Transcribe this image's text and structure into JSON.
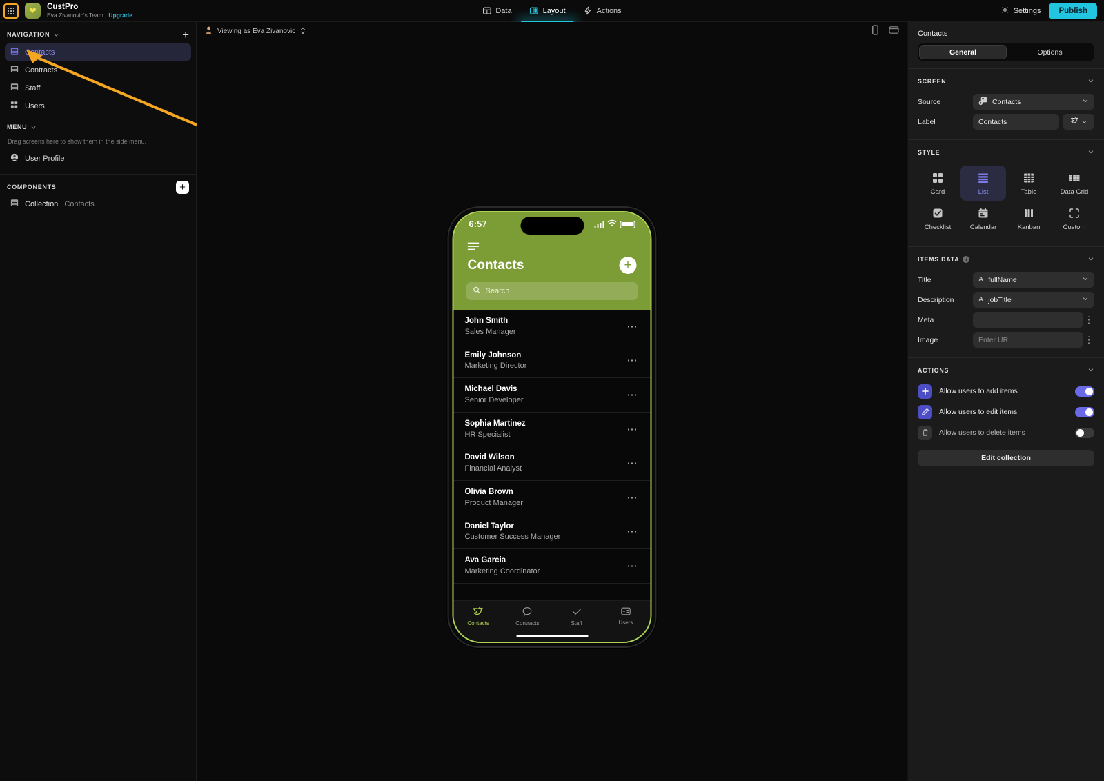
{
  "topbar": {
    "grid_icon": "grid-apps-icon",
    "logo_icon": "app-logo-icon",
    "app_title": "CustPro",
    "team": "Eva Zivanovic's Team",
    "sep": "·",
    "upgrade": "Upgrade",
    "tabs": [
      {
        "label": "Data",
        "icon": "data-table-icon",
        "active": false
      },
      {
        "label": "Layout",
        "icon": "layout-columns-icon",
        "active": true
      },
      {
        "label": "Actions",
        "icon": "lightning-bolt-icon",
        "active": false
      }
    ],
    "settings": "Settings",
    "publish": "Publish"
  },
  "sidebar": {
    "navigation": {
      "title": "NAVIGATION",
      "add_label": "+"
    },
    "nav_items": [
      {
        "label": "Contacts",
        "icon": "list-screen-icon",
        "active": true
      },
      {
        "label": "Contracts",
        "icon": "list-screen-icon",
        "active": false
      },
      {
        "label": "Staff",
        "icon": "list-screen-icon",
        "active": false
      },
      {
        "label": "Users",
        "icon": "grid-screen-icon",
        "active": false
      }
    ],
    "menu": {
      "title": "MENU",
      "hint": "Drag screens here to show them in the side menu."
    },
    "menu_items": [
      {
        "label": "User Profile",
        "icon": "user-avatar-icon"
      }
    ],
    "components": {
      "title": "COMPONENTS",
      "add_label": "+"
    },
    "component_items": [
      {
        "label": "Collection",
        "sub": "Contacts",
        "icon": "collection-icon"
      }
    ]
  },
  "canvas": {
    "viewing_as": "Viewing as Eva Zivanovic",
    "avatar_icon": "person-avatar-icon",
    "selector_icon": "up-down-chevron-icon",
    "mobile_view_icon": "mobile-device-icon",
    "desktop_view_icon": "desktop-device-icon"
  },
  "phone": {
    "status": {
      "time": "6:57",
      "signal_icon": "cellular-bars-icon",
      "wifi_icon": "wifi-icon",
      "battery_icon": "battery-icon"
    },
    "menu_icon": "hamburger-menu-icon",
    "title": "Contacts",
    "add_icon": "plus-circle-icon",
    "search_placeholder": "Search",
    "search_icon": "search-icon",
    "row_menu_icon": "ellipsis-icon",
    "contacts": [
      {
        "name": "John Smith",
        "job": "Sales Manager"
      },
      {
        "name": "Emily Johnson",
        "job": "Marketing Director"
      },
      {
        "name": "Michael Davis",
        "job": "Senior Developer"
      },
      {
        "name": "Sophia Martinez",
        "job": "HR Specialist"
      },
      {
        "name": "David Wilson",
        "job": "Financial Analyst"
      },
      {
        "name": "Olivia Brown",
        "job": "Product Manager"
      },
      {
        "name": "Daniel Taylor",
        "job": "Customer Success Manager"
      },
      {
        "name": "Ava Garcia",
        "job": "Marketing Coordinator"
      }
    ],
    "tabs": [
      {
        "label": "Contacts",
        "icon": "bird-icon",
        "active": true
      },
      {
        "label": "Contracts",
        "icon": "speech-bubble-icon",
        "active": false
      },
      {
        "label": "Staff",
        "icon": "check-icon",
        "active": false
      },
      {
        "label": "Users",
        "icon": "card-id-icon",
        "active": false
      }
    ]
  },
  "rpanel": {
    "title": "Contacts",
    "tabs": [
      {
        "label": "General",
        "active": true
      },
      {
        "label": "Options",
        "active": false
      }
    ],
    "screen": {
      "title": "SCREEN",
      "source_label": "Source",
      "source_value": "Contacts",
      "source_icon": "data-source-icon",
      "label_label": "Label",
      "label_value": "Contacts",
      "label_icon": "bird-icon"
    },
    "style": {
      "title": "STYLE",
      "options": [
        {
          "label": "Card",
          "icon": "card-layout-icon",
          "active": false
        },
        {
          "label": "List",
          "icon": "list-layout-icon",
          "active": true
        },
        {
          "label": "Table",
          "icon": "table-layout-icon",
          "active": false
        },
        {
          "label": "Data Grid",
          "icon": "data-grid-layout-icon",
          "active": false
        },
        {
          "label": "Checklist",
          "icon": "checklist-layout-icon",
          "active": false
        },
        {
          "label": "Calendar",
          "icon": "calendar-layout-icon",
          "active": false
        },
        {
          "label": "Kanban",
          "icon": "kanban-layout-icon",
          "active": false
        },
        {
          "label": "Custom",
          "icon": "custom-layout-icon",
          "active": false
        }
      ]
    },
    "items_data": {
      "title": "ITEMS DATA",
      "info_icon": "info-icon",
      "fields": [
        {
          "label": "Title",
          "type": "A",
          "value": "fullName",
          "kind": "select"
        },
        {
          "label": "Description",
          "type": "A",
          "value": "jobTitle",
          "kind": "select"
        },
        {
          "label": "Meta",
          "type": "",
          "value": "",
          "kind": "kebab"
        },
        {
          "label": "Image",
          "type": "",
          "value": "Enter URL",
          "kind": "kebab",
          "placeholder": true
        }
      ]
    },
    "actions": {
      "title": "ACTIONS",
      "items": [
        {
          "label": "Allow users to add items",
          "icon": "plus-icon",
          "on": true
        },
        {
          "label": "Allow users to edit items",
          "icon": "pencil-icon",
          "on": true
        },
        {
          "label": "Allow users to delete items",
          "icon": "trash-icon",
          "on": false
        }
      ],
      "edit_collection": "Edit collection"
    }
  },
  "colors": {
    "accent_cyan": "#22c5e0",
    "accent_purple": "#6a6ae8",
    "phone_green": "#7c9c35",
    "annotation_orange": "#f5a623"
  }
}
